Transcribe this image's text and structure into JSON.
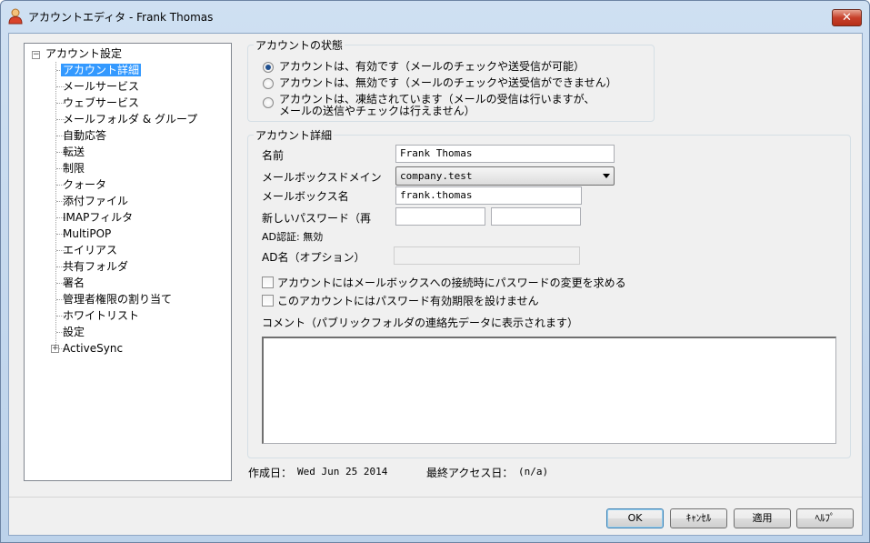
{
  "window": {
    "title": "アカウントエディタ - Frank Thomas",
    "close_glyph": "✕"
  },
  "tree": {
    "root": {
      "label": "アカウント設定",
      "expander": "−"
    },
    "items": [
      {
        "label": "アカウント詳細",
        "selected": true
      },
      {
        "label": "メールサービス"
      },
      {
        "label": "ウェブサービス"
      },
      {
        "label": "メールフォルダ & グループ"
      },
      {
        "label": "自動応答"
      },
      {
        "label": "転送"
      },
      {
        "label": "制限"
      },
      {
        "label": "クォータ"
      },
      {
        "label": "添付ファイル"
      },
      {
        "label": "IMAPフィルタ"
      },
      {
        "label": "MultiPOP"
      },
      {
        "label": "エイリアス"
      },
      {
        "label": "共有フォルダ"
      },
      {
        "label": "署名"
      },
      {
        "label": "管理者権限の割り当て"
      },
      {
        "label": "ホワイトリスト"
      },
      {
        "label": "設定"
      },
      {
        "label": "ActiveSync",
        "expander": "+"
      }
    ]
  },
  "status_group": {
    "title": "アカウントの状態",
    "options": [
      {
        "label": "アカウントは、有効です（メールのチェックや送受信が可能）",
        "checked": true
      },
      {
        "label": "アカウントは、無効です（メールのチェックや送受信ができません）",
        "checked": false
      },
      {
        "line1": "アカウントは、凍結されています（メールの受信は行いますが、",
        "line2": "メールの送信やチェックは行えません）",
        "checked": false
      }
    ]
  },
  "details_group": {
    "title": "アカウント詳細",
    "name_label": "名前",
    "name_value": "Frank Thomas",
    "domain_label": "メールボックスドメイン",
    "domain_value": "company.test",
    "mailbox_label": "メールボックス名",
    "mailbox_value": "frank.thomas",
    "password_label": "新しいパスワード（再",
    "password_value": "",
    "password_confirm_value": "",
    "ad_auth_label": "AD認証: 無効",
    "ad_name_label": "AD名（オプション）",
    "ad_name_value": "",
    "check_change_password": "アカウントにはメールボックスへの接続時にパスワードの変更を求める",
    "check_no_expiry": "このアカウントにはパスワード有効期限を設けません",
    "comment_label": "コメント（パブリックフォルダの連絡先データに表示されます）",
    "comment_value": ""
  },
  "footer_info": {
    "created_label": "作成日：",
    "created_value": "Wed Jun 25 2014",
    "last_access_label": "最終アクセス日：",
    "last_access_value": "(n/a)"
  },
  "buttons": {
    "ok": "OK",
    "cancel": "ｷｬﾝｾﾙ",
    "apply": "適用",
    "help": "ﾍﾙﾌﾟ"
  }
}
